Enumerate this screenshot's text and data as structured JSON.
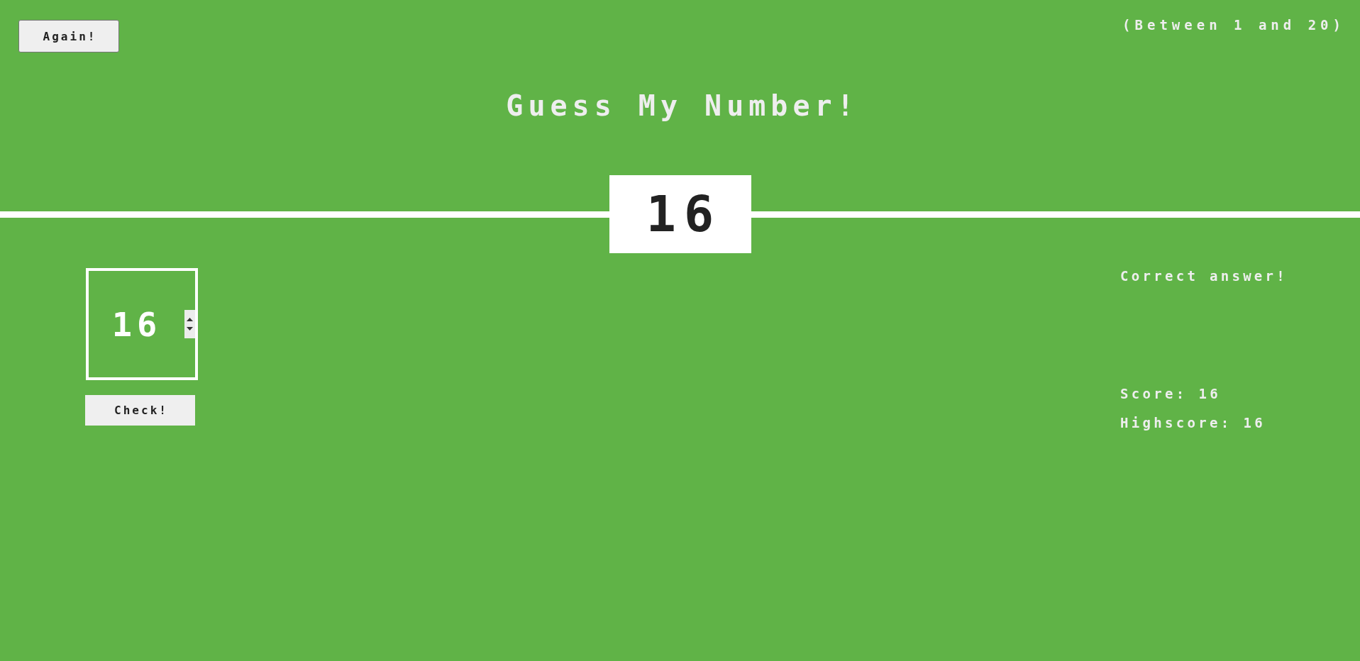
{
  "again_button": {
    "label": "Again!"
  },
  "range_hint": "(Between 1 and 20)",
  "title": "Guess My Number!",
  "secret_number": "16",
  "guess_input": {
    "value": "16"
  },
  "check_button": {
    "label": "Check!"
  },
  "message": "Correct answer!",
  "score": {
    "label": "Score:",
    "value": "16"
  },
  "highscore": {
    "label": "Highscore:",
    "value": "16"
  }
}
